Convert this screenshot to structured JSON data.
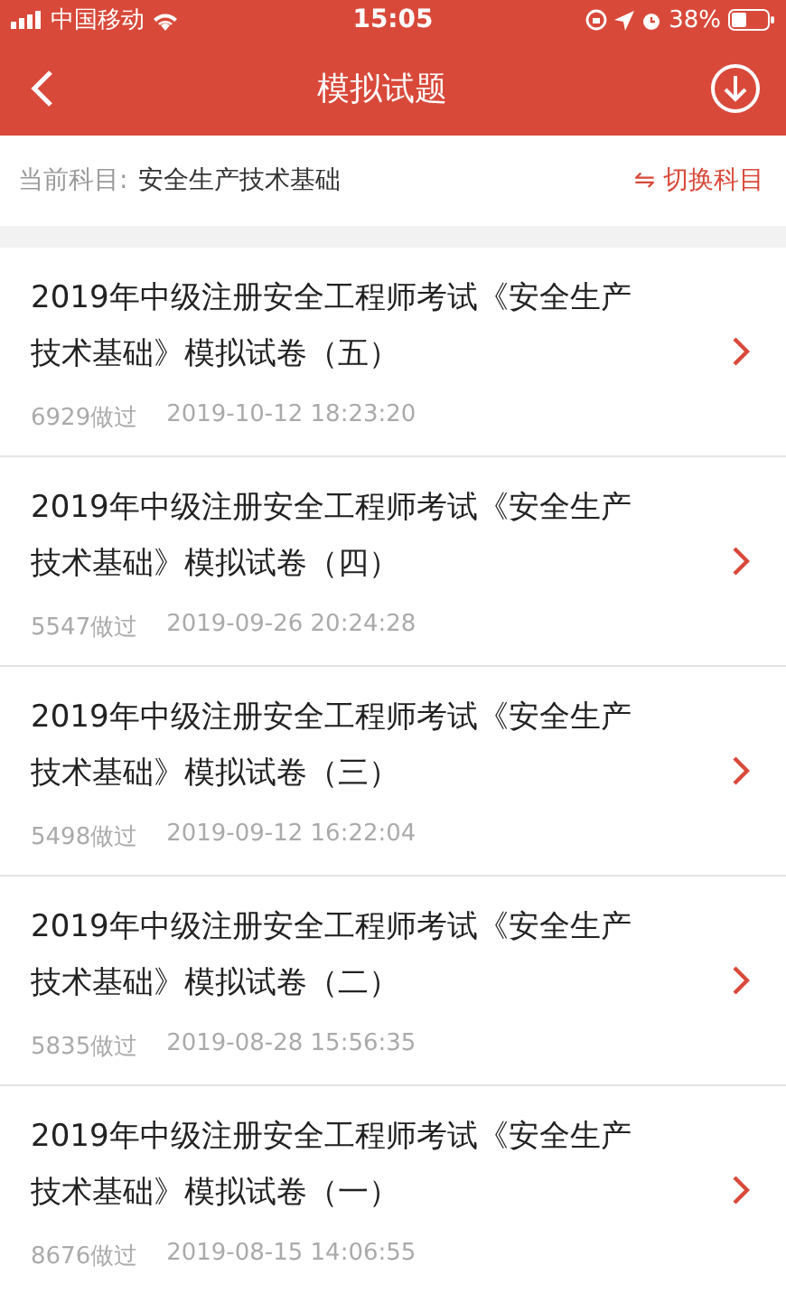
{
  "status_bar": {
    "carrier": "中国移动",
    "time": "15:05",
    "battery": "38%"
  },
  "nav": {
    "title": "模拟试题"
  },
  "subject": {
    "label": "当前科目:",
    "value": "安全生产技术基础",
    "switch_icon": "⇋",
    "switch_label": "切换科目"
  },
  "papers": [
    {
      "title": "2019年中级注册安全工程师考试《安全生产技术基础》模拟试卷（五）",
      "count": "6929做过",
      "time": "2019-10-12 18:23:20"
    },
    {
      "title": "2019年中级注册安全工程师考试《安全生产技术基础》模拟试卷（四）",
      "count": "5547做过",
      "time": "2019-09-26 20:24:28"
    },
    {
      "title": "2019年中级注册安全工程师考试《安全生产技术基础》模拟试卷（三）",
      "count": "5498做过",
      "time": "2019-09-12 16:22:04"
    },
    {
      "title": "2019年中级注册安全工程师考试《安全生产技术基础》模拟试卷（二）",
      "count": "5835做过",
      "time": "2019-08-28 15:56:35"
    },
    {
      "title": "2019年中级注册安全工程师考试《安全生产技术基础》模拟试卷（一）",
      "count": "8676做过",
      "time": "2019-08-15 14:06:55"
    }
  ]
}
